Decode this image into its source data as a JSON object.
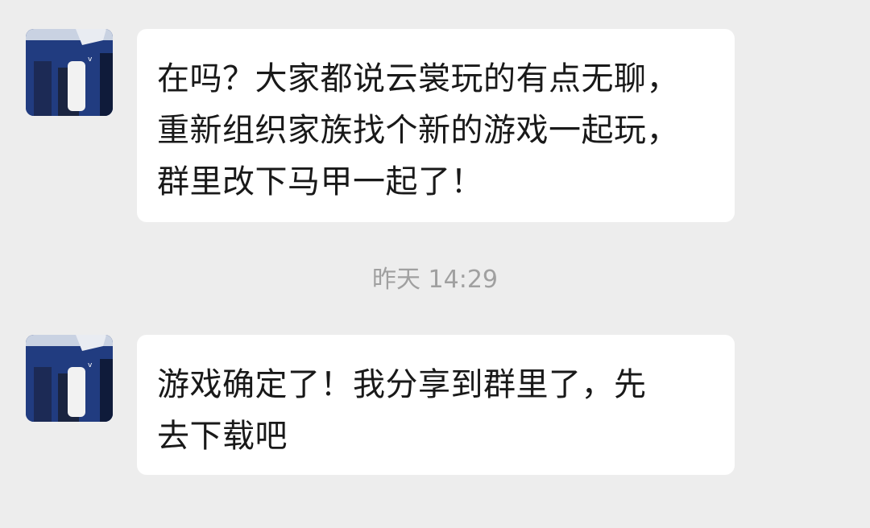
{
  "messages": [
    {
      "sender_avatar": "person-in-navy-shirt-avatar",
      "lines": [
        "在吗？大家都说云裳玩的有点无聊，",
        "重新组织家族找个新的游戏一起玩，",
        "群里改下马甲一起了！"
      ]
    },
    {
      "sender_avatar": "person-in-navy-shirt-avatar",
      "lines": [
        "游戏确定了！我分享到群里了，先",
        "去下载吧"
      ]
    }
  ],
  "timestamp": "昨天 14:29",
  "colors": {
    "background": "#ededed",
    "bubble": "#ffffff",
    "text": "#191919",
    "timestamp": "#a0a0a0",
    "avatar_shirt": "#1f3a7c"
  }
}
